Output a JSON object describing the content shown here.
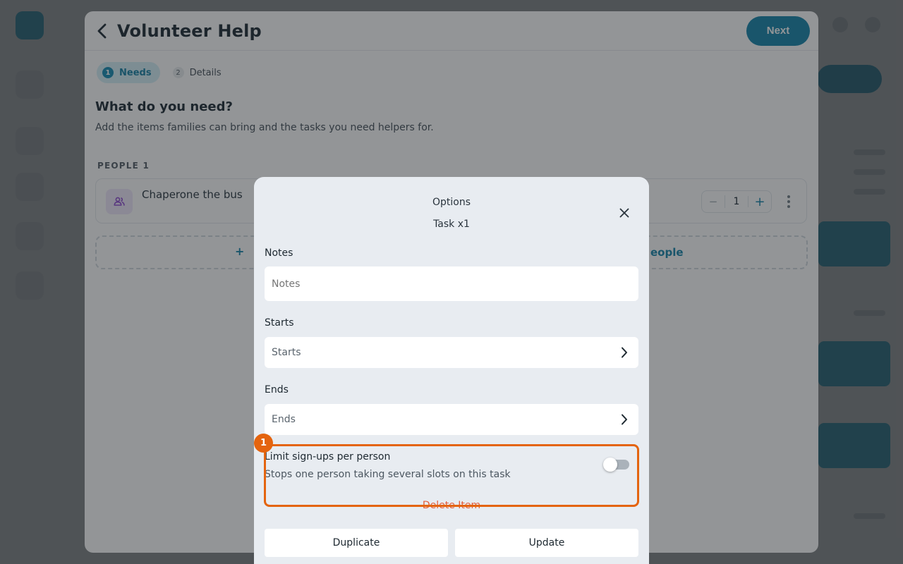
{
  "sheet": {
    "title": "Volunteer Help",
    "next_label": "Next",
    "steps": [
      {
        "num": "1",
        "label": "Needs"
      },
      {
        "num": "2",
        "label": "Details"
      }
    ],
    "section_title": "What do you need?",
    "section_subtitle": "Add the items families can bring and the tasks you need helpers for.",
    "people_label": "PEOPLE",
    "people_count": "1",
    "item": {
      "name": "Chaperone the bus",
      "quantity": "1"
    },
    "add_left_label": "+",
    "add_right_label": "eople"
  },
  "modal": {
    "title": "Options",
    "subtitle": "Task x1",
    "notes": {
      "label": "Notes",
      "placeholder": "Notes"
    },
    "starts": {
      "label": "Starts",
      "value": "Starts"
    },
    "ends": {
      "label": "Ends",
      "value": "Ends"
    },
    "limit": {
      "badge": "1",
      "title": "Limit sign-ups per person",
      "subtitle": "Stops one person taking several slots on this task",
      "enabled": false
    },
    "delete_label": "Delete Item",
    "duplicate_label": "Duplicate",
    "update_label": "Update"
  },
  "colors": {
    "accent": "#0a7fa6",
    "highlight": "#e4640f",
    "danger": "#e35d3a"
  }
}
